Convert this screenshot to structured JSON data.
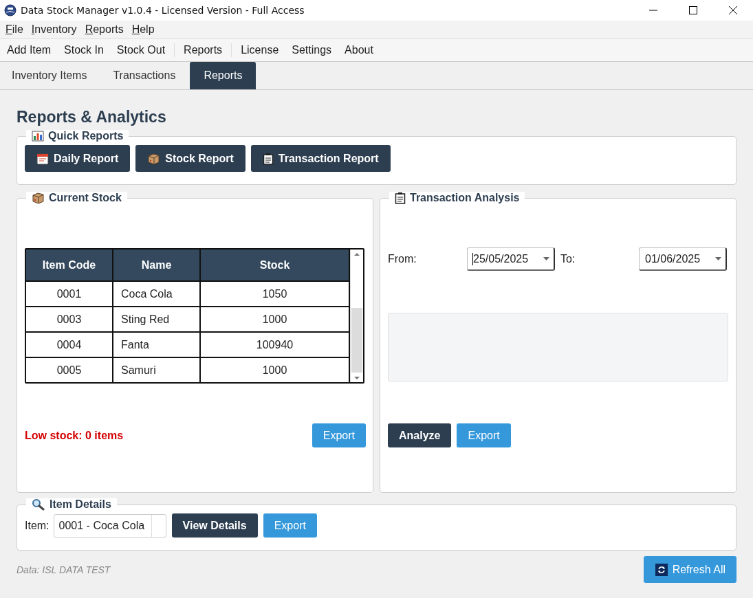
{
  "window": {
    "title": "Data Stock Manager v1.0.4 - Licensed Version - Full Access"
  },
  "menu": [
    "File",
    "Inventory",
    "Reports",
    "Help"
  ],
  "toolbar": [
    [
      "Add Item",
      "Stock In",
      "Stock Out"
    ],
    [
      "Reports"
    ],
    [
      "License",
      "Settings",
      "About"
    ]
  ],
  "tabs": [
    {
      "label": "Inventory Items",
      "selected": false
    },
    {
      "label": "Transactions",
      "selected": false
    },
    {
      "label": "Reports",
      "selected": true
    }
  ],
  "heading": "Reports & Analytics",
  "quick_reports": {
    "title": "Quick Reports",
    "buttons": [
      {
        "kind": "calendar",
        "label": "Daily Report"
      },
      {
        "kind": "box",
        "label": "Stock Report"
      },
      {
        "kind": "clipboard",
        "label": "Transaction Report"
      }
    ]
  },
  "current_stock": {
    "title": "Current Stock",
    "table": {
      "columns": [
        "Item Code",
        "Name",
        "Stock"
      ],
      "rows": [
        [
          "0001",
          "Coca Cola",
          "1050"
        ],
        [
          "0003",
          "Sting Red",
          "1000"
        ],
        [
          "0004",
          "Fanta",
          "100940"
        ],
        [
          "0005",
          "Samuri",
          "1000"
        ]
      ]
    },
    "low_stock": "Low stock: 0 items",
    "export": "Export"
  },
  "transaction_analysis": {
    "title": "Transaction Analysis",
    "from_label": "From:",
    "from": {
      "value": "25/05/2025",
      "focused": true
    },
    "to_label": "To:",
    "to": {
      "value": "01/06/2025",
      "focused": false
    },
    "analyze": "Analyze",
    "export": "Export"
  },
  "item_details": {
    "title": "Item Details",
    "label": "Item:",
    "item": "0001 - Coca Cola",
    "view": "View Details",
    "export": "Export"
  },
  "footer": {
    "data": "Data: ISL DATA TEST",
    "refresh": "Refresh All"
  }
}
